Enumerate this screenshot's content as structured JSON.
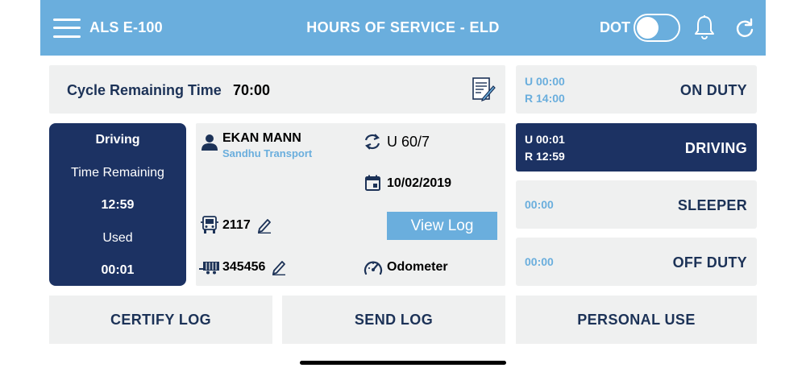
{
  "header": {
    "app_name": "ALS E-100",
    "title": "HOURS OF SERVICE - ELD",
    "dot_label": "DOT",
    "dot_toggle_on": false,
    "background_color": "#6aaedd"
  },
  "cycle": {
    "label": "Cycle Remaining Time",
    "value": "70:00",
    "icon": "document-edit-icon"
  },
  "driving_card": {
    "title": "Driving",
    "time_remaining_label": "Time Remaining",
    "time_remaining": "12:59",
    "used_label": "Used",
    "used": "00:01"
  },
  "driver": {
    "name": "EKAN MANN",
    "carrier": "Sandhu Transport",
    "cycle_rule": "U 60/7",
    "date": "10/02/2019",
    "truck_number": "2117",
    "trailer_number": "345456",
    "view_log_label": "View Log",
    "odometer_label": "Odometer"
  },
  "statuses": [
    {
      "u": "U 00:00",
      "r": "R 14:00",
      "label": "ON DUTY",
      "active": false
    },
    {
      "u": "U 00:01",
      "r": "R 12:59",
      "label": "DRIVING",
      "active": true
    },
    {
      "time": "00:00",
      "label": "SLEEPER",
      "active": false
    },
    {
      "time": "00:00",
      "label": "OFF DUTY",
      "active": false
    }
  ],
  "buttons": {
    "certify": "CERTIFY LOG",
    "send": "SEND LOG",
    "personal": "PERSONAL USE"
  },
  "colors": {
    "accent": "#6aaedd",
    "navy": "#1c3263",
    "panel": "#eff0f0"
  }
}
